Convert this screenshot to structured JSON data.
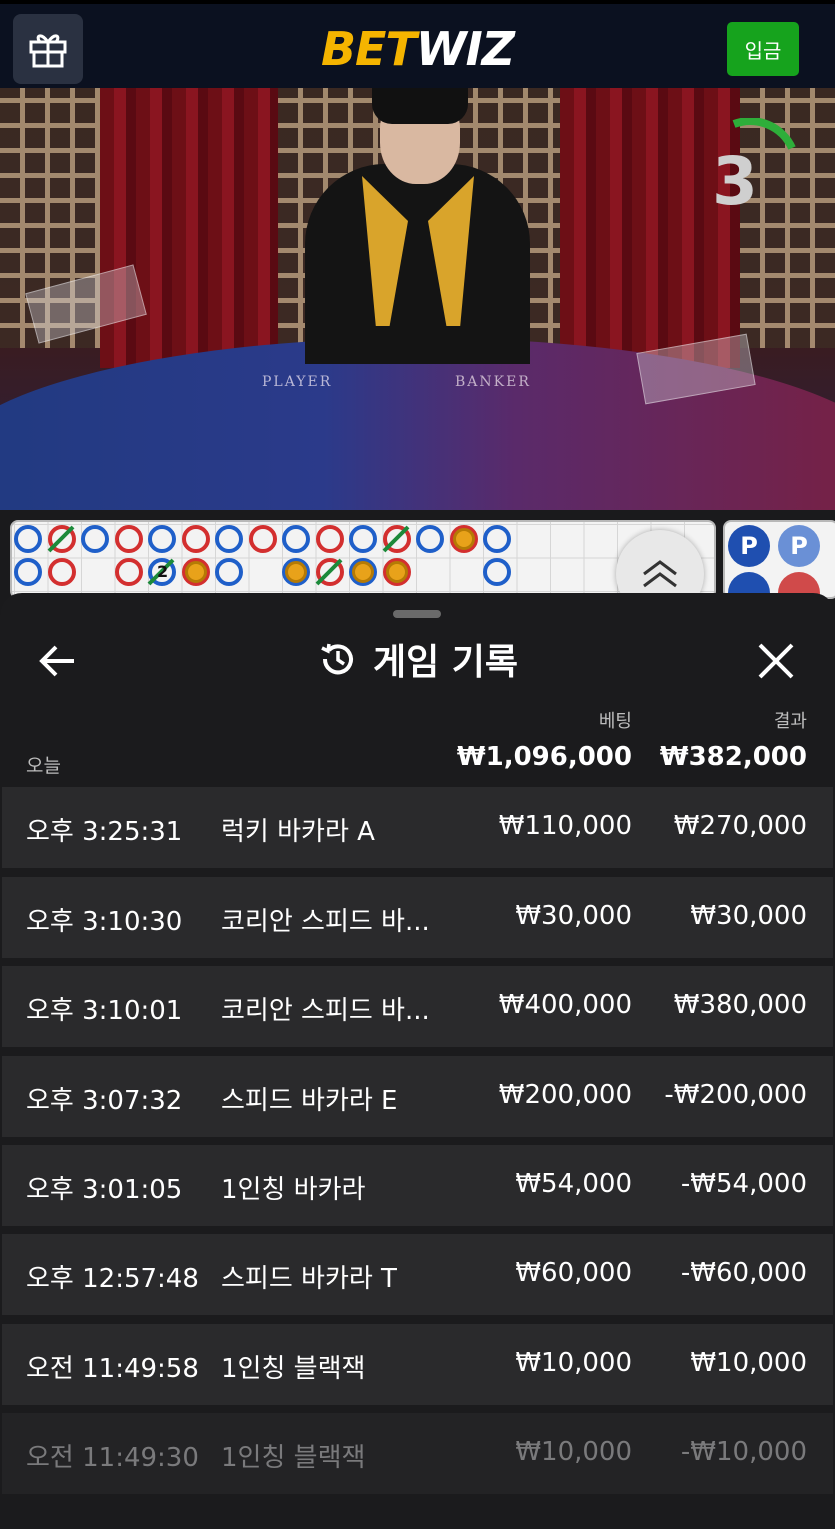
{
  "header": {
    "logo_part1": "BET",
    "logo_part2": "WIZ",
    "deposit_label": "입금",
    "colors": {
      "logo_accent": "#f5b400",
      "deposit": "#16a31d"
    }
  },
  "video": {
    "table_player": "PLAYER",
    "table_banker": "BANKER",
    "countdown": "3"
  },
  "road": {
    "badges": [
      "P",
      "P"
    ],
    "tie_count": "2"
  },
  "history": {
    "title": "게임 기록",
    "col_bet": "베팅",
    "col_result": "결과",
    "today_label": "오늘",
    "total_bet": "₩1,096,000",
    "total_result": "₩382,000",
    "rows": [
      {
        "time": "오후 3:25:31",
        "game": "럭키 바카라 A",
        "bet": "₩110,000",
        "result": "₩270,000"
      },
      {
        "time": "오후 3:10:30",
        "game": "코리안 스피드 바...",
        "bet": "₩30,000",
        "result": "₩30,000"
      },
      {
        "time": "오후 3:10:01",
        "game": "코리안 스피드 바...",
        "bet": "₩400,000",
        "result": "₩380,000"
      },
      {
        "time": "오후 3:07:32",
        "game": "스피드 바카라 E",
        "bet": "₩200,000",
        "result": "-₩200,000"
      },
      {
        "time": "오후 3:01:05",
        "game": "1인칭 바카라",
        "bet": "₩54,000",
        "result": "-₩54,000"
      },
      {
        "time": "오후 12:57:48",
        "game": "스피드 바카라 T",
        "bet": "₩60,000",
        "result": "-₩60,000"
      },
      {
        "time": "오전 11:49:58",
        "game": "1인칭 블랙잭",
        "bet": "₩10,000",
        "result": "₩10,000"
      },
      {
        "time": "오전 11:49:30",
        "game": "1인칭 블랙잭",
        "bet": "₩10,000",
        "result": "-₩10,000"
      }
    ]
  }
}
